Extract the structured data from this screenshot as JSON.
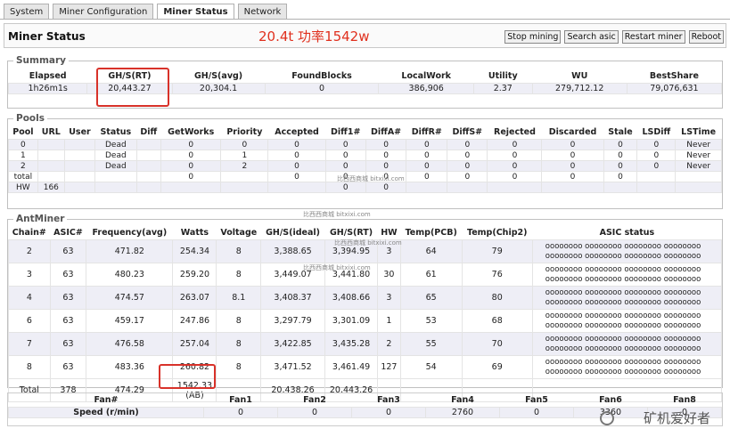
{
  "tabs": [
    "System",
    "Miner Configuration",
    "Miner Status",
    "Network"
  ],
  "title": "Miner Status",
  "annotation": "20.4t  功率1542w",
  "actions": [
    "Stop mining",
    "Search asic",
    "Restart miner",
    "Reboot"
  ],
  "summary": {
    "legend": "Summary",
    "headers": [
      "Elapsed",
      "GH/S(RT)",
      "GH/S(avg)",
      "FoundBlocks",
      "LocalWork",
      "Utility",
      "WU",
      "BestShare"
    ],
    "values": [
      "1h26m1s",
      "20,443.27",
      "20,304.1",
      "0",
      "386,906",
      "2.37",
      "279,712.12",
      "79,076,631"
    ]
  },
  "pools": {
    "legend": "Pools",
    "headers": [
      "Pool",
      "URL",
      "User",
      "Status",
      "Diff",
      "GetWorks",
      "Priority",
      "Accepted",
      "Diff1#",
      "DiffA#",
      "DiffR#",
      "DiffS#",
      "Rejected",
      "Discarded",
      "Stale",
      "LSDiff",
      "LSTime"
    ],
    "rows": [
      [
        "0",
        "",
        "",
        "Dead",
        "",
        "0",
        "0",
        "0",
        "0",
        "0",
        "0",
        "0",
        "0",
        "0",
        "0",
        "0",
        "Never"
      ],
      [
        "1",
        "",
        "",
        "Dead",
        "",
        "0",
        "1",
        "0",
        "0",
        "0",
        "0",
        "0",
        "0",
        "0",
        "0",
        "0",
        "Never"
      ],
      [
        "2",
        "",
        "",
        "Dead",
        "",
        "0",
        "2",
        "0",
        "0",
        "0",
        "0",
        "0",
        "0",
        "0",
        "0",
        "0",
        "Never"
      ],
      [
        "total",
        "",
        "",
        "",
        "",
        "0",
        "",
        "0",
        "0",
        "0",
        "0",
        "0",
        "0",
        "0",
        "0",
        "",
        ""
      ],
      [
        "HW",
        "166",
        "",
        "",
        "",
        "",
        "",
        "",
        "0",
        "0",
        "",
        "",
        "",
        "",
        "",
        "",
        ""
      ]
    ]
  },
  "antminer": {
    "legend": "AntMiner",
    "headers": [
      "Chain#",
      "ASIC#",
      "Frequency(avg)",
      "Watts",
      "Voltage",
      "GH/S(ideal)",
      "GH/S(RT)",
      "HW",
      "Temp(PCB)",
      "Temp(Chip2)",
      "ASIC status"
    ],
    "status_line": "oooooooo oooooooo oooooooo oooooooo",
    "rows": [
      [
        "2",
        "63",
        "471.82",
        "254.34",
        "8",
        "3,388.65",
        "3,394.95",
        "3",
        "64",
        "79"
      ],
      [
        "3",
        "63",
        "480.23",
        "259.20",
        "8",
        "3,449.07",
        "3,441.80",
        "30",
        "61",
        "76"
      ],
      [
        "4",
        "63",
        "474.57",
        "263.07",
        "8.1",
        "3,408.37",
        "3,408.66",
        "3",
        "65",
        "80"
      ],
      [
        "6",
        "63",
        "459.17",
        "247.86",
        "8",
        "3,297.79",
        "3,301.09",
        "1",
        "53",
        "68"
      ],
      [
        "7",
        "63",
        "476.58",
        "257.04",
        "8",
        "3,422.85",
        "3,435.28",
        "2",
        "55",
        "70"
      ],
      [
        "8",
        "63",
        "483.36",
        "260.82",
        "8",
        "3,471.52",
        "3,461.49",
        "127",
        "54",
        "69"
      ]
    ],
    "total": {
      "label": "Total",
      "asic": "378",
      "freq": "474.29",
      "watts": "1542.33",
      "watts_note": "(AB)",
      "ideal": "20,438.26",
      "rt": "20,443.26"
    }
  },
  "fans": {
    "headers": [
      "Fan#",
      "Fan1",
      "Fan2",
      "Fan3",
      "Fan4",
      "Fan5",
      "Fan6",
      "Fan8"
    ],
    "row_label": "Speed (r/min)",
    "values": [
      "0",
      "0",
      "0",
      "2760",
      "0",
      "3360",
      "0"
    ]
  },
  "watermarks": [
    "比西西商城 bitxixi.com",
    "矿机爱好者"
  ]
}
